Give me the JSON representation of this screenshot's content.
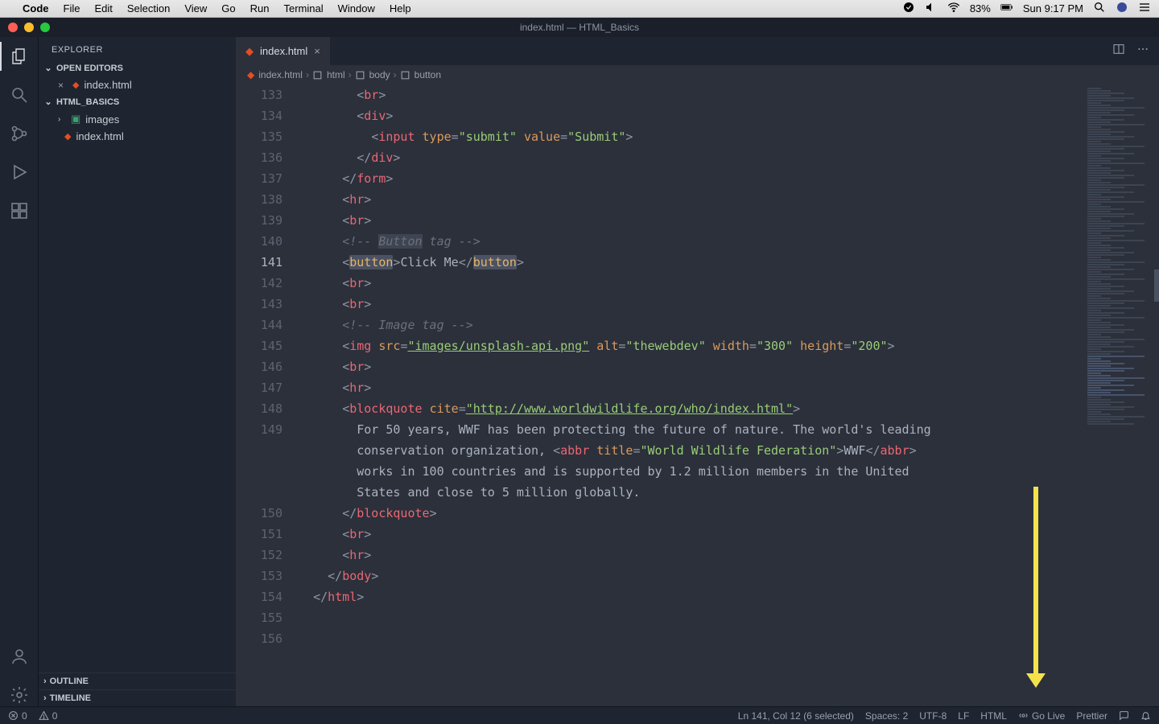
{
  "menubar": {
    "appname": "Code",
    "items": [
      "File",
      "Edit",
      "Selection",
      "View",
      "Go",
      "Run",
      "Terminal",
      "Window",
      "Help"
    ],
    "battery_pct": "83%",
    "clock": "Sun 9:17 PM"
  },
  "titlebar": {
    "title": "index.html — HTML_Basics"
  },
  "sidebar": {
    "title": "EXPLORER",
    "open_editors_label": "OPEN EDITORS",
    "open_editors": [
      {
        "name": "index.html"
      }
    ],
    "workspace_label": "HTML_BASICS",
    "tree": [
      {
        "type": "folder",
        "name": "images"
      },
      {
        "type": "file",
        "name": "index.html"
      }
    ],
    "outline_label": "OUTLINE",
    "timeline_label": "TIMELINE"
  },
  "tab": {
    "name": "index.html"
  },
  "breadcrumb": {
    "file": "index.html",
    "path": [
      "html",
      "body",
      "button"
    ]
  },
  "code_lines": [
    {
      "n": 133,
      "indent": 4,
      "tok": [
        [
          "br",
          "<"
        ],
        [
          "tag",
          "br"
        ],
        [
          "br",
          ">"
        ]
      ]
    },
    {
      "n": 134,
      "indent": 4,
      "tok": [
        [
          "br",
          "<"
        ],
        [
          "tag",
          "div"
        ],
        [
          "br",
          ">"
        ]
      ]
    },
    {
      "n": 135,
      "indent": 5,
      "tok": [
        [
          "br",
          "<"
        ],
        [
          "tag",
          "input"
        ],
        [
          "txt",
          " "
        ],
        [
          "attr",
          "type"
        ],
        [
          "br",
          "="
        ],
        [
          "str",
          "\"submit\""
        ],
        [
          "txt",
          " "
        ],
        [
          "attr",
          "value"
        ],
        [
          "br",
          "="
        ],
        [
          "str",
          "\"Submit\""
        ],
        [
          "br",
          ">"
        ]
      ]
    },
    {
      "n": 136,
      "indent": 4,
      "tok": [
        [
          "br",
          "</"
        ],
        [
          "tag",
          "div"
        ],
        [
          "br",
          ">"
        ]
      ]
    },
    {
      "n": 137,
      "indent": 3,
      "tok": [
        [
          "br",
          "</"
        ],
        [
          "tag",
          "form"
        ],
        [
          "br",
          ">"
        ]
      ]
    },
    {
      "n": 138,
      "indent": 3,
      "tok": [
        [
          "br",
          "<"
        ],
        [
          "tag",
          "hr"
        ],
        [
          "br",
          ">"
        ]
      ]
    },
    {
      "n": 139,
      "indent": 3,
      "tok": [
        [
          "br",
          "<"
        ],
        [
          "tag",
          "br"
        ],
        [
          "br",
          ">"
        ]
      ]
    },
    {
      "n": 140,
      "indent": 3,
      "tok": [
        [
          "cmt",
          "<!-- "
        ],
        [
          "cmtsel",
          "Button"
        ],
        [
          "cmt",
          " tag -->"
        ]
      ]
    },
    {
      "n": 141,
      "indent": 3,
      "active": true,
      "tok": [
        [
          "br",
          "<"
        ],
        [
          "hl",
          "button"
        ],
        [
          "br",
          ">"
        ],
        [
          "txt",
          "Click Me"
        ],
        [
          "br",
          "</"
        ],
        [
          "hl",
          "button"
        ],
        [
          "br",
          ">"
        ]
      ]
    },
    {
      "n": 142,
      "indent": 3,
      "tok": [
        [
          "br",
          "<"
        ],
        [
          "tag",
          "br"
        ],
        [
          "br",
          ">"
        ]
      ]
    },
    {
      "n": 143,
      "indent": 3,
      "tok": [
        [
          "br",
          "<"
        ],
        [
          "tag",
          "br"
        ],
        [
          "br",
          ">"
        ]
      ]
    },
    {
      "n": 144,
      "indent": 3,
      "tok": [
        [
          "cmt",
          "<!-- Image tag -->"
        ]
      ]
    },
    {
      "n": 145,
      "indent": 3,
      "tok": [
        [
          "br",
          "<"
        ],
        [
          "tag",
          "img"
        ],
        [
          "txt",
          " "
        ],
        [
          "attr",
          "src"
        ],
        [
          "br",
          "="
        ],
        [
          "strurl",
          "\"images/unsplash-api.png\""
        ],
        [
          "txt",
          " "
        ],
        [
          "attr",
          "alt"
        ],
        [
          "br",
          "="
        ],
        [
          "str",
          "\"thewebdev\""
        ],
        [
          "txt",
          " "
        ],
        [
          "attr",
          "width"
        ],
        [
          "br",
          "="
        ],
        [
          "str",
          "\"300\""
        ],
        [
          "txt",
          " "
        ],
        [
          "attr",
          "height"
        ],
        [
          "br",
          "="
        ],
        [
          "str",
          "\"200\""
        ],
        [
          "br",
          ">"
        ]
      ]
    },
    {
      "n": 146,
      "indent": 3,
      "tok": [
        [
          "br",
          "<"
        ],
        [
          "tag",
          "br"
        ],
        [
          "br",
          ">"
        ]
      ]
    },
    {
      "n": 147,
      "indent": 3,
      "tok": [
        [
          "br",
          "<"
        ],
        [
          "tag",
          "hr"
        ],
        [
          "br",
          ">"
        ]
      ]
    },
    {
      "n": 148,
      "indent": 3,
      "tok": [
        [
          "br",
          "<"
        ],
        [
          "tag",
          "blockquote"
        ],
        [
          "txt",
          " "
        ],
        [
          "attr",
          "cite"
        ],
        [
          "br",
          "="
        ],
        [
          "strurl",
          "\"http://www.worldwildlife.org/who/index.html\""
        ],
        [
          "br",
          ">"
        ]
      ]
    },
    {
      "n": 149,
      "indent": 4,
      "tok": [
        [
          "txt",
          "For 50 years, WWF has been protecting the future of nature. The world's leading "
        ]
      ]
    },
    {
      "n": "",
      "indent": 4,
      "tok": [
        [
          "txt",
          "conservation organization, "
        ],
        [
          "br",
          "<"
        ],
        [
          "tag",
          "abbr"
        ],
        [
          "txt",
          " "
        ],
        [
          "attr",
          "title"
        ],
        [
          "br",
          "="
        ],
        [
          "str",
          "\"World Wildlife Federation\""
        ],
        [
          "br",
          ">"
        ],
        [
          "txt",
          "WWF"
        ],
        [
          "br",
          "</"
        ],
        [
          "tag",
          "abbr"
        ],
        [
          "br",
          ">"
        ],
        [
          "txt",
          " "
        ]
      ]
    },
    {
      "n": "",
      "indent": 4,
      "tok": [
        [
          "txt",
          "works in 100 countries and is supported by 1.2 million members in the United "
        ]
      ]
    },
    {
      "n": "",
      "indent": 4,
      "tok": [
        [
          "txt",
          "States and close to 5 million globally."
        ]
      ]
    },
    {
      "n": 150,
      "indent": 3,
      "tok": [
        [
          "br",
          "</"
        ],
        [
          "tag",
          "blockquote"
        ],
        [
          "br",
          ">"
        ]
      ]
    },
    {
      "n": 151,
      "indent": 3,
      "tok": [
        [
          "br",
          "<"
        ],
        [
          "tag",
          "br"
        ],
        [
          "br",
          ">"
        ]
      ]
    },
    {
      "n": 152,
      "indent": 3,
      "tok": [
        [
          "br",
          "<"
        ],
        [
          "tag",
          "hr"
        ],
        [
          "br",
          ">"
        ]
      ]
    },
    {
      "n": 153,
      "indent": 2,
      "tok": [
        [
          "br",
          "</"
        ],
        [
          "tag",
          "body"
        ],
        [
          "br",
          ">"
        ]
      ]
    },
    {
      "n": 154,
      "indent": 1,
      "tok": [
        [
          "br",
          "</"
        ],
        [
          "tag",
          "html"
        ],
        [
          "br",
          ">"
        ]
      ]
    },
    {
      "n": 155,
      "indent": 0,
      "tok": []
    },
    {
      "n": 156,
      "indent": 0,
      "tok": []
    }
  ],
  "statusbar": {
    "errors": "0",
    "warnings": "0",
    "cursor": "Ln 141, Col 12 (6 selected)",
    "spaces": "Spaces: 2",
    "encoding": "UTF-8",
    "eol": "LF",
    "lang": "HTML",
    "golive": "Go Live",
    "prettier": "Prettier"
  }
}
